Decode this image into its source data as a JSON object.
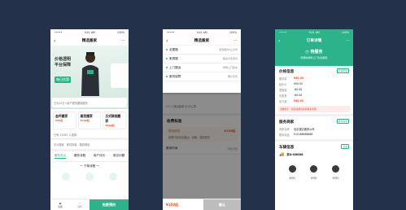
{
  "phone1": {
    "status": {
      "carrier": "•••••",
      "time": "9:41 AM",
      "battery": "100%"
    },
    "nav_title": "精选搬家",
    "hero": {
      "line1": "价格透明",
      "line2": "平台保障",
      "badge": "每日优惠"
    },
    "strip_text": "已为10万+用户提供搬家服务",
    "services": [
      {
        "name": "金杯搬家",
        "price": "¥99起"
      },
      {
        "name": "厢货搬家",
        "price": "¥199起"
      },
      {
        "name": "日式精细搬家",
        "price": "¥299起"
      }
    ],
    "row_text": "已有 23587 人选择",
    "tags": [
      "平价搬家",
      "家具拆装",
      "搬前规划"
    ],
    "tabs": [
      "服务亮点",
      "服务流程",
      "用户评价",
      "常见问题"
    ],
    "section": "一 下单流程 一",
    "bottom": {
      "service": "客服",
      "share": "分享",
      "cta": "免费预约"
    }
  },
  "phone2": {
    "status": {
      "carrier": "•••••",
      "time": "9:41 AM",
      "battery": "100%"
    },
    "nav_title": "精选搬家",
    "options": [
      {
        "name": "全屋搬",
        "desc": "装载量约5立方米"
      },
      {
        "name": "家具搬",
        "desc": "搬运大件家具"
      },
      {
        "name": "上门搬运",
        "desc": "师傅上门装车"
      },
      {
        "name": "服务保障",
        "desc": "赔付无忧"
      }
    ],
    "people": "2个人·搬运距离 约10公里",
    "fee_title": "收费标准",
    "fee_label": "基础服务",
    "fee_price": "¥150起",
    "note": "套餐内容包含搬运、运输、装卸服务",
    "time_label": "服务时间",
    "time_value": "5月10日",
    "total": "¥150起",
    "submit": "确认"
  },
  "phone3": {
    "status": {
      "carrier": "•••••",
      "time": "9:41 AM",
      "battery": "100%"
    },
    "nav_title": "订单详情",
    "state": "待服务",
    "state_desc": "师傅将按时上门为您服务",
    "price_title": "价格信息",
    "price_link": "查看明细",
    "prices": [
      {
        "k": "服务费",
        "v": "¥80.00"
      },
      {
        "k": "起步价",
        "v": "¥50.00"
      },
      {
        "k": "里程费",
        "v": "-¥0.00"
      },
      {
        "k": "优惠券",
        "v": "-¥0.00"
      },
      {
        "k": "实付款",
        "v": "¥80.00"
      }
    ],
    "notice": "温馨提示：如需改期请提前联系客服",
    "merchant_title": "服务商家",
    "merchant_link": "联系商家",
    "merchant": [
      {
        "k": "商家名称",
        "v": "北京速达搬家公司"
      },
      {
        "k": "联系电话",
        "v": "010-88888888"
      }
    ],
    "vehicle_title": "车辆信息",
    "vehicle_link": "查看",
    "plate": "京A-88888",
    "crew": [
      "师傅1",
      "师傅2",
      "师傅3"
    ]
  },
  "colors": {
    "accent": "#2db38a",
    "price": "#f05a28",
    "background": "#23324a"
  }
}
